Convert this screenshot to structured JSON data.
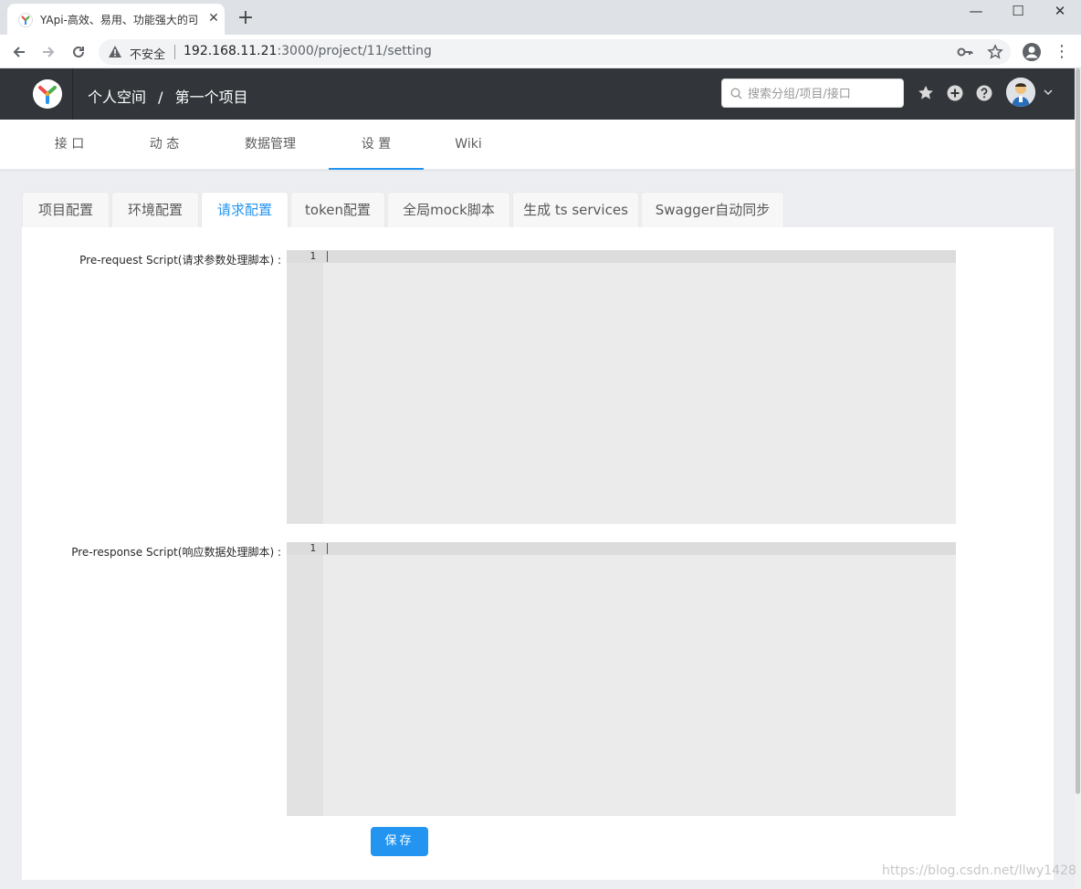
{
  "browser": {
    "tab_title": "YApi-高效、易用、功能强大的可",
    "tab_close": "✕",
    "new_tab": "+",
    "insecure_label": "不安全",
    "url_host": "192.168.11.21",
    "url_rest": ":3000/project/11/setting",
    "window_controls": {
      "minimize": "—",
      "maximize": "☐",
      "close": "✕"
    }
  },
  "header": {
    "breadcrumb": [
      "个人空间",
      "/",
      "第一个项目"
    ],
    "search_placeholder": "搜索分组/项目/接口"
  },
  "subnav": {
    "items": [
      "接 口",
      "动 态",
      "数据管理",
      "设 置",
      "Wiki"
    ],
    "active_index": 3
  },
  "setting_tabs": {
    "items": [
      "项目配置",
      "环境配置",
      "请求配置",
      "token配置",
      "全局mock脚本",
      "生成 ts services",
      "Swagger自动同步"
    ],
    "active_index": 2
  },
  "form": {
    "pre_request_label": "Pre-request Script(请求参数处理脚本) :",
    "pre_response_label": "Pre-response Script(响应数据处理脚本) :",
    "pre_request_line_no": "1",
    "pre_response_line_no": "1",
    "save_label": "保存"
  },
  "watermark": "https://blog.csdn.net/llwy1428",
  "colors": {
    "header_bg": "#32363a",
    "accent": "#2395f1",
    "editor_bg": "#ebebeb"
  }
}
